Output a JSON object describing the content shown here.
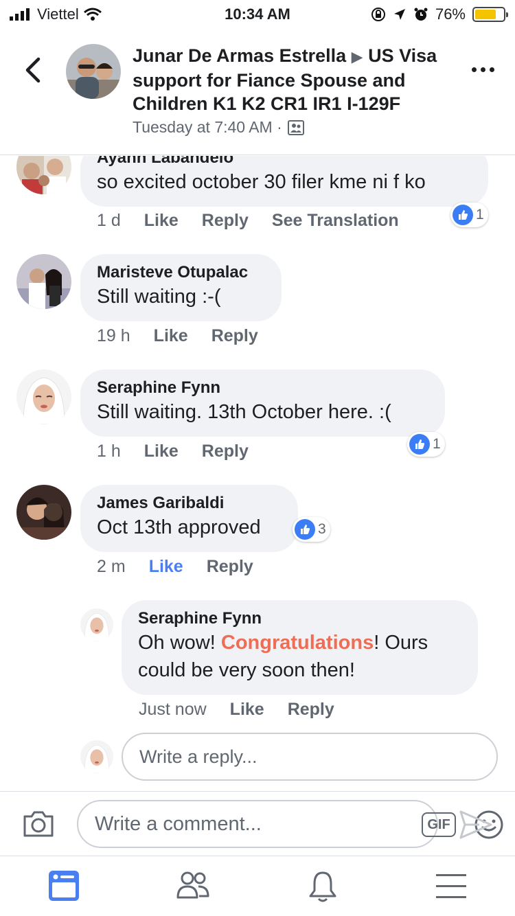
{
  "status_bar": {
    "carrier": "Viettel",
    "time": "10:34 AM",
    "battery": "76%",
    "battery_level": 0.76
  },
  "header": {
    "title_part1": "Junar De Armas Estrella",
    "title_part2": "US Visa support for Fiance Spouse and Children K1 K2 CR1 IR1 I-129F",
    "subtitle": "Tuesday at 7:40 AM ·",
    "icons": [
      "back-icon",
      "group-icon",
      "more-icon"
    ]
  },
  "comments": [
    {
      "name": "Ayahn Labandelo",
      "text": "so excited october 30 filer kme ni f ko",
      "time": "1 d",
      "like": "Like",
      "reply": "Reply",
      "translate": "See Translation",
      "reactions": "1"
    },
    {
      "name": "Maristeve Otupalac",
      "text": "Still waiting :-(",
      "time": "19 h",
      "like": "Like",
      "reply": "Reply"
    },
    {
      "name": "Seraphine Fynn",
      "text": "Still waiting. 13th October here. :(",
      "time": "1 h",
      "like": "Like",
      "reply": "Reply",
      "reactions": "1"
    },
    {
      "name": "James Garibaldi",
      "text": "Oct 13th approved",
      "time": "2 m",
      "like": "Like",
      "reply": "Reply",
      "reactions": "3",
      "liked": true
    }
  ],
  "reply": {
    "name": "Seraphine Fynn",
    "text_before": "Oh wow! ",
    "text_highlight": "Congratulations",
    "text_after": "! Ours could be very soon then!",
    "time": "Just now",
    "like": "Like",
    "reply": "Reply"
  },
  "reply_input": {
    "placeholder": "Write a reply..."
  },
  "composer": {
    "placeholder": "Write a comment...",
    "gif": "GIF",
    "icons": [
      "camera-icon",
      "gif-icon",
      "emoji-icon",
      "send-icon"
    ]
  },
  "tabbar": {
    "icons": [
      "news-feed-icon",
      "friends-icon",
      "notifications-icon",
      "menu-icon"
    ]
  },
  "colors": {
    "accent": "#4a7ff2",
    "highlight": "#ee6d55",
    "bubble": "#f0f2f5",
    "muted": "#606770"
  }
}
